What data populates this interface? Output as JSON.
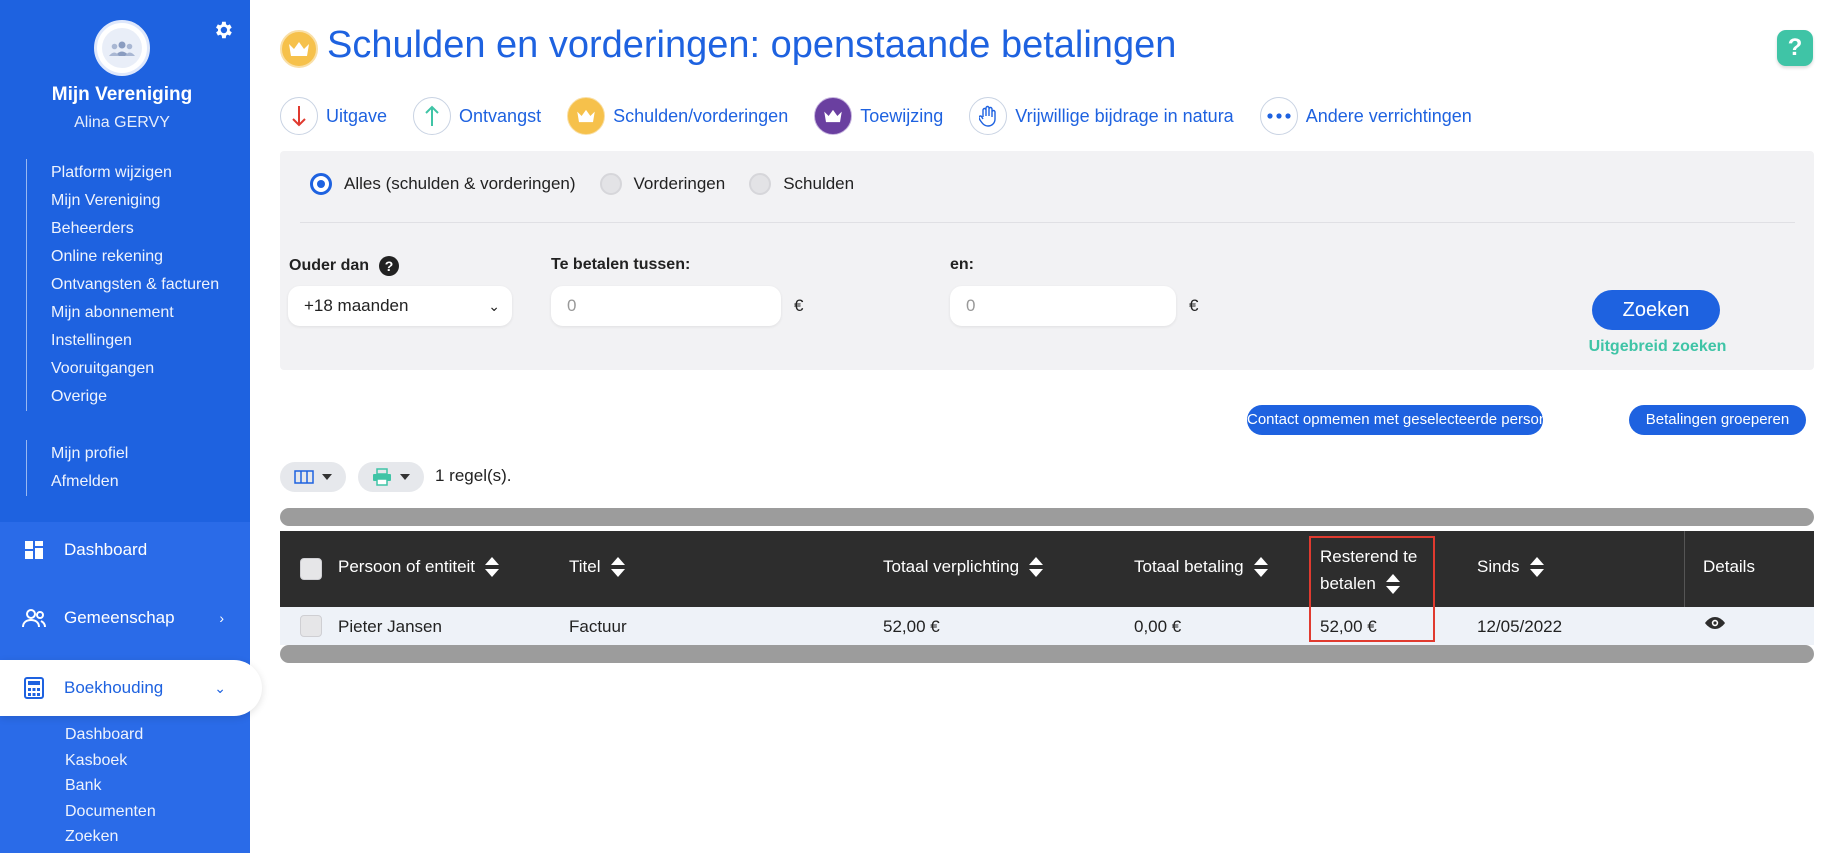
{
  "sidebar": {
    "org_name": "Mijn Vereniging",
    "user_name": "Alina GERVY",
    "settings_links": [
      "Platform wijzigen",
      "Mijn Vereniging",
      "Beheerders",
      "Online rekening",
      "Ontvangsten & facturen",
      "Mijn abonnement",
      "Instellingen",
      "Vooruitgangen",
      "Overige"
    ],
    "profile_links": [
      "Mijn profiel",
      "Afmelden"
    ],
    "nav": {
      "dashboard": "Dashboard",
      "community": "Gemeenschap",
      "accounting": "Boekhouding"
    },
    "accounting_sub": [
      "Dashboard",
      "Kasboek",
      "Bank",
      "Documenten",
      "Zoeken"
    ]
  },
  "page": {
    "title": "Schulden en vorderingen: openstaande betalingen",
    "help_label": "?"
  },
  "actions": [
    {
      "label": "Uitgave",
      "icon": "arrow-down-icon",
      "color": "#e03a2f"
    },
    {
      "label": "Ontvangst",
      "icon": "arrow-up-icon",
      "color": "#3fc4a6"
    },
    {
      "label": "Schulden/vorderingen",
      "icon": "crown-icon",
      "color": "#f6c14b"
    },
    {
      "label": "Toewijzing",
      "icon": "crown-transfer-icon",
      "color": "#6a3fa0"
    },
    {
      "label": "Vrijwillige bijdrage in natura",
      "icon": "hand-icon",
      "color": "#1e62e0"
    },
    {
      "label": "Andere verrichtingen",
      "icon": "more-icon",
      "color": "#1e62e0"
    }
  ],
  "filters": {
    "radios": [
      {
        "label": "Alles (schulden & vorderingen)",
        "checked": true
      },
      {
        "label": "Vorderingen",
        "checked": false
      },
      {
        "label": "Schulden",
        "checked": false
      }
    ],
    "older_than_label": "Ouder dan",
    "older_than_value": "+18 maanden",
    "between_label": "Te betalen tussen:",
    "between_value": "0",
    "and_label": "en:",
    "and_value": "0",
    "currency": "€",
    "search_button": "Zoeken",
    "advanced_search": "Uitgebreid zoeken"
  },
  "buttons": {
    "contact": "Contact opmemen met geselecteerde personen",
    "group": "Betalingen groeperen"
  },
  "toolbar": {
    "row_count": "1 regel(s)."
  },
  "table": {
    "headers": {
      "person": "Persoon of entiteit",
      "title": "Titel",
      "total_obligation": "Totaal verplichting",
      "total_payment": "Totaal betaling",
      "remaining_1": "Resterend te",
      "remaining_2": "betalen",
      "since": "Sinds",
      "details": "Details"
    },
    "rows": [
      {
        "person": "Pieter Jansen",
        "title": "Factuur",
        "total_obligation": "52,00 €",
        "total_payment": "0,00 €",
        "remaining": "52,00 €",
        "since": "12/05/2022"
      }
    ]
  },
  "colors": {
    "brand": "#1e62e0",
    "accent_green": "#3fc4a6",
    "highlight": "#e03a2f"
  }
}
